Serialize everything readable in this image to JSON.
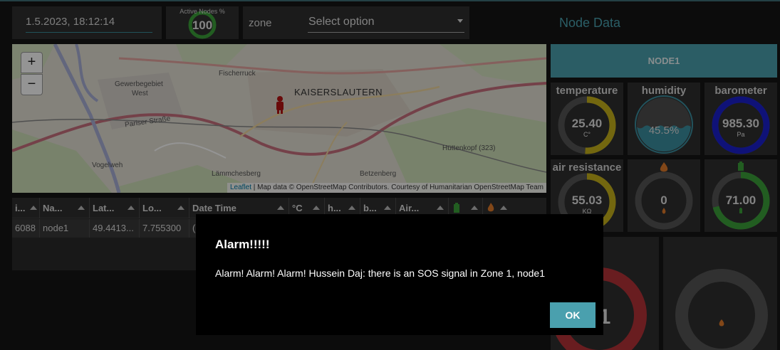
{
  "header": {
    "datetime": "1.5.2023, 18:12:14",
    "active_nodes_label": "Active Nodes %",
    "active_nodes_value": "100",
    "active_nodes_fraction": 1.0,
    "zone_label": "zone",
    "zone_select_value": "Select option",
    "node_data_title": "Node Data"
  },
  "map": {
    "zoom_in": "+",
    "zoom_out": "−",
    "city_label": "KAISERSLAUTERN",
    "places": [
      "Fischerruck",
      "Gewerbegebiet",
      "West",
      "Pariser Straße",
      "Vogelweh",
      "Lämmchesberg",
      "Betzenberg",
      "Hüttenkopf (323)"
    ],
    "attribution_leaflet": "Leaflet",
    "attribution_text": " | Map data © OpenStreetMap Contributors. Courtesy of Humanitarian OpenStreetMap Team"
  },
  "table": {
    "columns": [
      "i...",
      "Na...",
      "Lat...",
      "Lo...",
      "Date Time",
      "°C",
      "h...",
      "b...",
      "Air..."
    ],
    "rows": [
      [
        "6088",
        "node1",
        "49.4413...",
        "7.755300",
        "("
      ]
    ]
  },
  "node_panel": {
    "node_button": "NODE1",
    "gauges": {
      "temperature": {
        "title": "temperature",
        "value": "25.40",
        "unit": "C°",
        "fraction": 0.51,
        "color": "#c6b21a"
      },
      "humidity": {
        "title": "humidity",
        "value": "45.5%",
        "level": 0.455,
        "color": "#3c8fa0"
      },
      "barometer": {
        "title": "barometer",
        "value": "985.30",
        "unit": "Pa",
        "fraction": 1.0,
        "color": "#1a1fcf"
      },
      "air_resistance": {
        "title": "air resistance",
        "value": "55.03",
        "unit": "KΩ",
        "fraction": 0.5,
        "color": "#c6b21a"
      },
      "fire": {
        "value": "0",
        "fraction": 0.0,
        "icon": "fire-icon"
      },
      "battery": {
        "value": "71.00",
        "fraction": 0.71,
        "color": "#3ca03a",
        "icon": "battery-icon"
      }
    },
    "big_gauge_1": {
      "value": "1",
      "color": "#b53238"
    }
  },
  "modal": {
    "title": "Alarm!!!!!",
    "message": "Alarm! Alarm! Alarm! Hussein Daj: there is an SOS signal in Zone 1, node1",
    "ok_label": "OK"
  }
}
